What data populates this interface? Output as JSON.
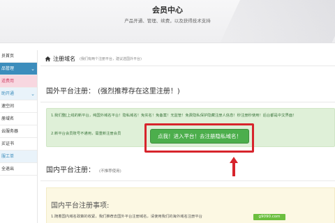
{
  "header": {
    "title": "会员中心",
    "subtitle": "产品开通、管理、续费，以及获得技术支持"
  },
  "sidebar": {
    "items": [
      {
        "label": "员首页",
        "state": "normal"
      },
      {
        "label": "品管理",
        "state": "active",
        "chevron": true
      },
      {
        "label": "道费用",
        "state": "pink"
      },
      {
        "label": "助开通",
        "state": "soft",
        "chevron": true
      },
      {
        "label": "速空间",
        "state": "normal"
      },
      {
        "label": "册域名",
        "state": "normal"
      },
      {
        "label": "云服务器",
        "state": "normal"
      },
      {
        "label": "买证书",
        "state": "normal"
      },
      {
        "label": "服工单",
        "state": "soft"
      },
      {
        "label": "全退出",
        "state": "normal"
      }
    ]
  },
  "breadcrumb": {
    "icon": "home-icon",
    "title": "注册域名",
    "note": "(我们有两个注册平台，建议选国外平台)"
  },
  "sections": {
    "intl_heading": "国外平台注册：",
    "intl_recommend": "(强烈推荐存在这里注册！)",
    "notice_line1": "1.我们整[上线的新平台，纯国外域名平台！隐私域名！免实名！免备案！无监管！免费隐私保护隐藏注册人信息！秒注册秒使用！后台都是中文界面！",
    "notice_line2": "2.新平台会员账号不通用，需重新注册会员",
    "go_button": "点我！进入平台！去注册隐私域名！",
    "domestic_heading": "国内平台注册：",
    "domestic_note": "(不推荐使用)",
    "notes_heading": "国内平台注册事项:",
    "notes_line1": "1.随着国内域名政策的收紧，我们推荐去国外平台注册域名，请使用我们的海外域名注册平台",
    "watermark": "g9090.com"
  },
  "colors": {
    "accent": "#3c8dbc",
    "button_green": "#4cae4c",
    "highlight_red": "#d7242c",
    "notice_bg": "#dff0d8",
    "notes_bg": "#fcf8e3"
  }
}
